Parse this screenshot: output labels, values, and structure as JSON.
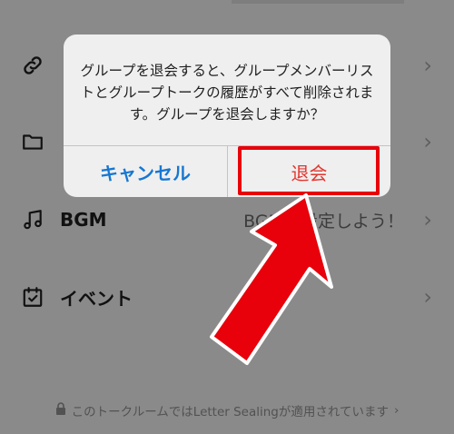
{
  "rows": {
    "folder": {
      "label": ""
    },
    "bgm": {
      "label": "BGM",
      "value": "BGMを設定しよう！"
    },
    "event": {
      "label": "イベント"
    }
  },
  "chevron": "›",
  "footer": {
    "text": "このトークルームではLetter Sealingが適用されています"
  },
  "dialog": {
    "message": "グループを退会すると、グループメンバーリストとグループトークの履歴がすべて削除されます。グループを退会しますか？",
    "cancel_label": "キャンセル",
    "leave_label": "退会"
  },
  "colors": {
    "cancel": "#1677d2",
    "leave": "#e2362f",
    "annotation": "#e8000b",
    "overlay": "#8a8a8a"
  },
  "icons": {
    "link": "link-icon",
    "folder": "folder-icon",
    "music": "music-note-icon",
    "event": "calendar-check-icon",
    "lock": "lock-icon"
  }
}
